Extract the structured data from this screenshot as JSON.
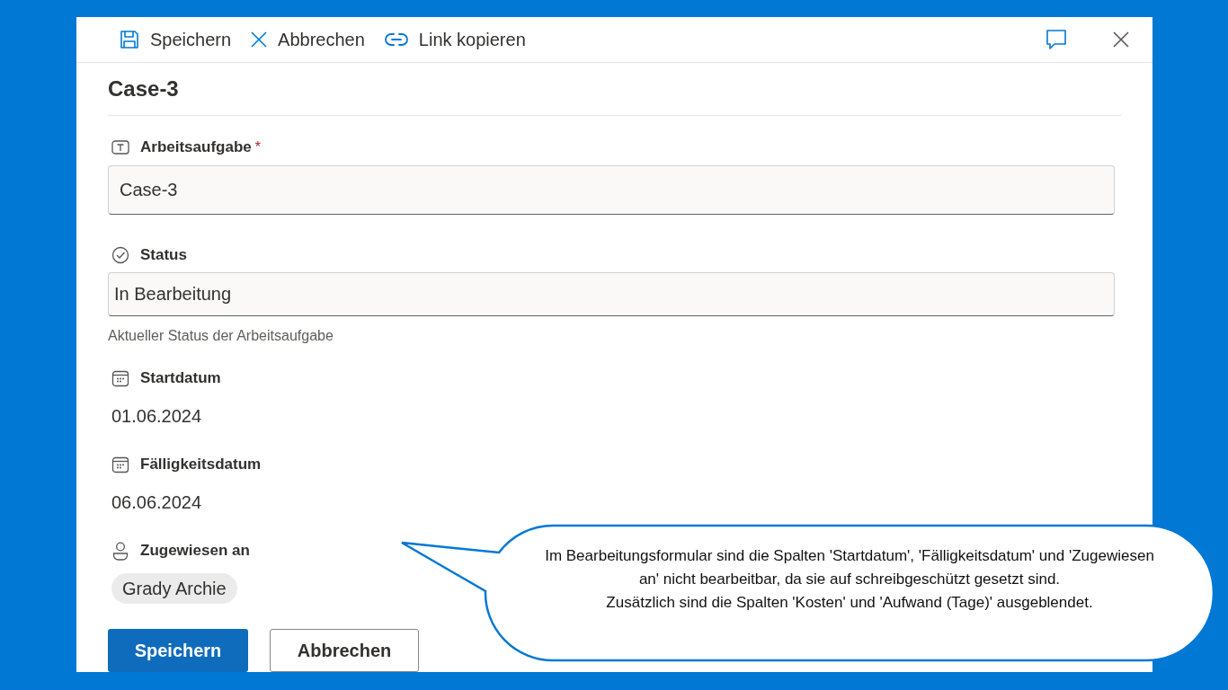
{
  "toolbar": {
    "items": [
      {
        "kind": "save",
        "label": "Speichern"
      },
      {
        "kind": "cancel",
        "label": "Abbrechen"
      },
      {
        "kind": "link",
        "label": "Link kopieren"
      }
    ]
  },
  "title": "Case-3",
  "fields": [
    {
      "kind": "text",
      "label": "Arbeitsaufgabe",
      "required_mark": "*",
      "value": "Case-3"
    },
    {
      "kind": "choice",
      "label": "Status",
      "value": "In Bearbeitung",
      "hint": "Aktueller Status der Arbeitsaufgabe"
    },
    {
      "kind": "date",
      "label": "Startdatum",
      "value": "01.06.2024"
    },
    {
      "kind": "date",
      "label": "Fälligkeitsdatum",
      "value": "06.06.2024"
    },
    {
      "kind": "person",
      "label": "Zugewiesen an",
      "value": "Grady Archie"
    }
  ],
  "buttons": [
    {
      "kind": "primary",
      "label": "Speichern"
    },
    {
      "kind": "secondary",
      "label": "Abbrechen"
    }
  ],
  "callout": {
    "paragraphs": [
      "Im Bearbeitungsformular sind die Spalten 'Startdatum', 'Fälligkeitsdatum' und 'Zugewiesen an' nicht bearbeitbar, da sie auf schreibgeschützt gesetzt sind.",
      "Zusätzlich sind die Spalten 'Kosten' und 'Aufwand (Tage)' ausgeblendet."
    ]
  }
}
